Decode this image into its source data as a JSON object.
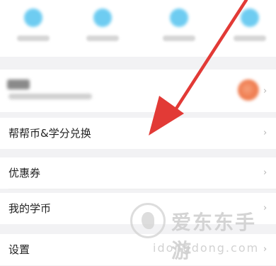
{
  "quick_actions": [
    {
      "icon": "app-icon-1"
    },
    {
      "icon": "app-icon-2"
    },
    {
      "icon": "app-icon-3"
    },
    {
      "icon": "app-icon-4"
    }
  ],
  "menu": {
    "exchange_label": "帮帮币&学分兑换",
    "coupons_label": "优惠券",
    "my_coins_label": "我的学币",
    "settings_label": "设置"
  },
  "watermark": {
    "site_name": "爱东东手游",
    "url": "idongdong.com"
  },
  "colors": {
    "icon_blue": "#5fc7f0",
    "arrow_red": "#e23a36",
    "badge_orange": "#ef7b4f"
  }
}
